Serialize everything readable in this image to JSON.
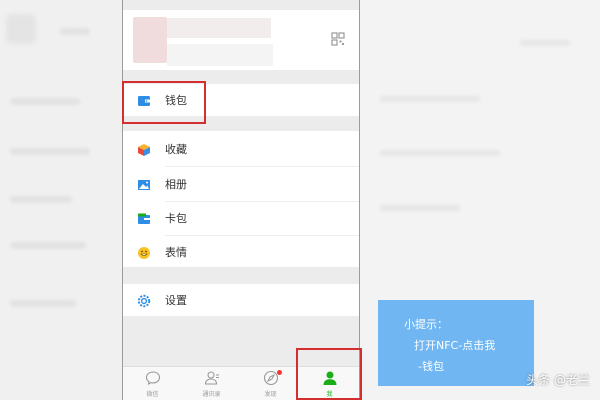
{
  "menu": {
    "wallet_label": "钱包",
    "favorites_label": "收藏",
    "album_label": "相册",
    "cards_label": "卡包",
    "stickers_label": "表情",
    "settings_label": "设置"
  },
  "tabbar": {
    "chats": "微信",
    "contacts": "通讯录",
    "discover": "发现",
    "me": "我"
  },
  "tip": {
    "line1": "小提示：",
    "line2": "打开NFC-点击我",
    "line3": "-钱包"
  },
  "watermark": "头条 @老兰",
  "colors": {
    "accent_green": "#1aad19",
    "highlight_red": "#d32f2f",
    "tip_blue": "#6fb6f2",
    "badge_red": "#f43530"
  },
  "icons": {
    "qr": "qr-code-icon",
    "wallet": "wallet-icon",
    "favorites": "favorites-cube-icon",
    "album": "photo-icon",
    "cards": "card-icon",
    "stickers": "smiley-icon",
    "settings": "gear-icon"
  }
}
